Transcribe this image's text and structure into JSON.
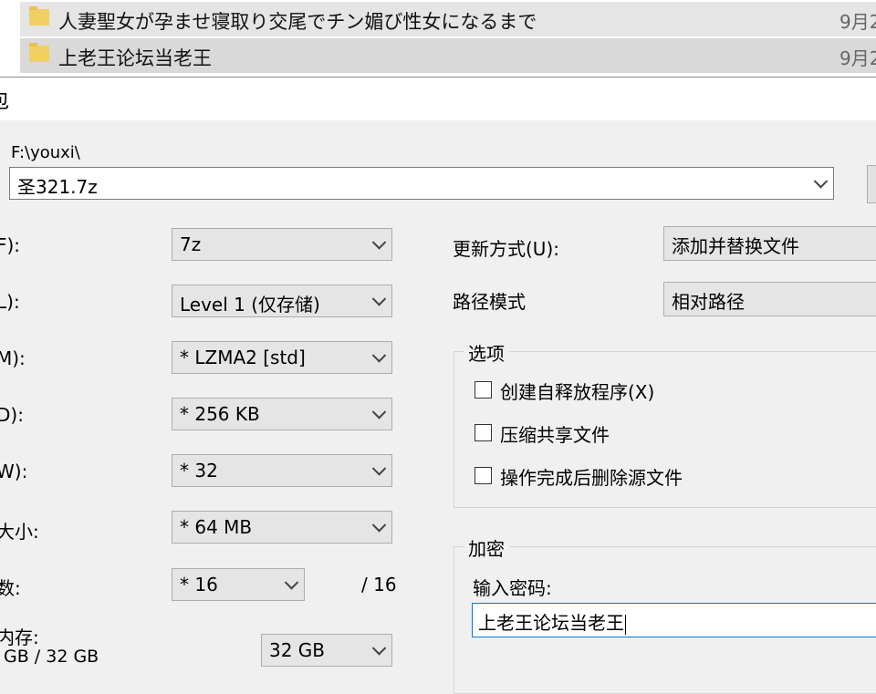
{
  "explorer": {
    "rows": [
      {
        "name": "人妻聖女が孕ませ寝取り交尾でチン媚び性女になるまで",
        "date": "9月2"
      },
      {
        "name": "上老王论坛当老王",
        "date": "9月2"
      }
    ]
  },
  "dialog": {
    "title": "包",
    "path": "F:\\youxi\\",
    "archive_name": "圣321.7z",
    "left_fields": [
      {
        "label": "F):",
        "value": "7z"
      },
      {
        "label": "L):",
        "value": "Level 1 (仅存储)"
      },
      {
        "label": "M):",
        "value": "* LZMA2 [std]"
      },
      {
        "label": "D):",
        "value": "* 256 KB"
      },
      {
        "label": "W):",
        "value": "* 32"
      },
      {
        "label": "大小:",
        "value": "* 64 MB"
      },
      {
        "label": "数:",
        "value": "* 16"
      }
    ],
    "threads_max": "/ 16",
    "memory": {
      "label": "内存:",
      "usage": "GB / 32 GB",
      "value": "32 GB"
    },
    "update_mode": {
      "label": "更新方式(U):",
      "value": "添加并替换文件"
    },
    "path_mode": {
      "label": "路径模式",
      "value": "相对路径"
    },
    "options": {
      "title": "选项",
      "items": [
        "创建自释放程序(X)",
        "压缩共享文件",
        "操作完成后删除源文件"
      ]
    },
    "encryption": {
      "title": "加密",
      "password_label": "输入密码:",
      "password_value": "上老王论坛当老王"
    }
  }
}
